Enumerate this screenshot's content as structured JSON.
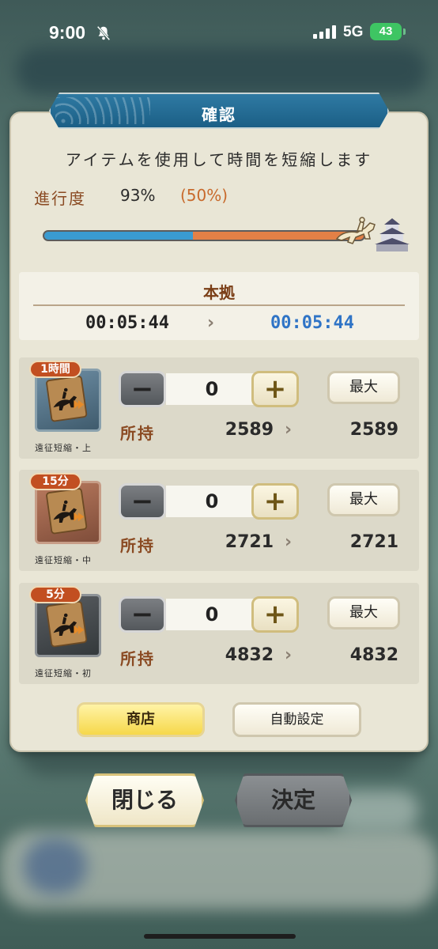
{
  "status_bar": {
    "time": "9:00",
    "network": "5G",
    "battery": "43"
  },
  "dialog": {
    "title": "確認",
    "description": "アイテムを使用して時間を短縮します",
    "progress": {
      "label": "進行度",
      "value": "93%",
      "extra": "(50%)",
      "fraction": 0.465
    },
    "time_panel": {
      "heading": "本拠",
      "from": "00:05:44",
      "arrow": "›",
      "to": "00:05:44"
    },
    "items": [
      {
        "tag": "1時間",
        "name": "遠征短縮・上",
        "quantity": "0",
        "max_label": "最大",
        "own_label": "所持",
        "owned": "2589",
        "owned_after": "2589",
        "icon": "blue"
      },
      {
        "tag": "15分",
        "name": "遠征短縮・中",
        "quantity": "0",
        "max_label": "最大",
        "own_label": "所持",
        "owned": "2721",
        "owned_after": "2721",
        "icon": "brown"
      },
      {
        "tag": "5分",
        "name": "遠征短縮・初",
        "quantity": "0",
        "max_label": "最大",
        "own_label": "所持",
        "owned": "4832",
        "owned_after": "4832",
        "icon": "gray"
      }
    ],
    "shop_button": "商店",
    "auto_button": "自動設定"
  },
  "footer": {
    "close_button": "閉じる",
    "confirm_button": "決定"
  },
  "colors": {
    "accent_blue": "#3a9bd1",
    "accent_orange": "#e38046",
    "shop_yellow": "#f6d84a"
  }
}
